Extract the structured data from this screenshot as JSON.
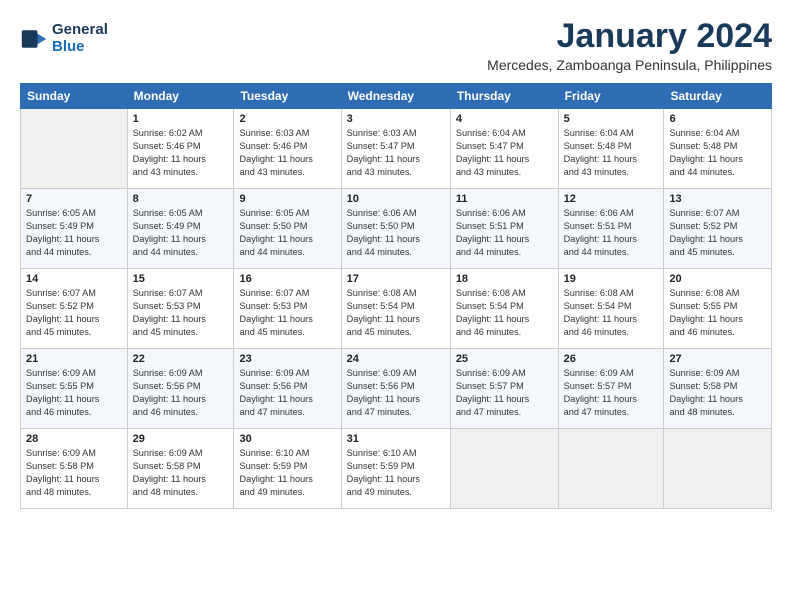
{
  "header": {
    "logo_line1": "General",
    "logo_line2": "Blue",
    "title": "January 2024",
    "location": "Mercedes, Zamboanga Peninsula, Philippines"
  },
  "weekdays": [
    "Sunday",
    "Monday",
    "Tuesday",
    "Wednesday",
    "Thursday",
    "Friday",
    "Saturday"
  ],
  "weeks": [
    [
      {
        "day": "",
        "sunrise": "",
        "sunset": "",
        "daylight": ""
      },
      {
        "day": "1",
        "sunrise": "6:02 AM",
        "sunset": "5:46 PM",
        "daylight": "11 hours and 43 minutes."
      },
      {
        "day": "2",
        "sunrise": "6:03 AM",
        "sunset": "5:46 PM",
        "daylight": "11 hours and 43 minutes."
      },
      {
        "day": "3",
        "sunrise": "6:03 AM",
        "sunset": "5:47 PM",
        "daylight": "11 hours and 43 minutes."
      },
      {
        "day": "4",
        "sunrise": "6:04 AM",
        "sunset": "5:47 PM",
        "daylight": "11 hours and 43 minutes."
      },
      {
        "day": "5",
        "sunrise": "6:04 AM",
        "sunset": "5:48 PM",
        "daylight": "11 hours and 43 minutes."
      },
      {
        "day": "6",
        "sunrise": "6:04 AM",
        "sunset": "5:48 PM",
        "daylight": "11 hours and 44 minutes."
      }
    ],
    [
      {
        "day": "7",
        "sunrise": "6:05 AM",
        "sunset": "5:49 PM",
        "daylight": "11 hours and 44 minutes."
      },
      {
        "day": "8",
        "sunrise": "6:05 AM",
        "sunset": "5:49 PM",
        "daylight": "11 hours and 44 minutes."
      },
      {
        "day": "9",
        "sunrise": "6:05 AM",
        "sunset": "5:50 PM",
        "daylight": "11 hours and 44 minutes."
      },
      {
        "day": "10",
        "sunrise": "6:06 AM",
        "sunset": "5:50 PM",
        "daylight": "11 hours and 44 minutes."
      },
      {
        "day": "11",
        "sunrise": "6:06 AM",
        "sunset": "5:51 PM",
        "daylight": "11 hours and 44 minutes."
      },
      {
        "day": "12",
        "sunrise": "6:06 AM",
        "sunset": "5:51 PM",
        "daylight": "11 hours and 44 minutes."
      },
      {
        "day": "13",
        "sunrise": "6:07 AM",
        "sunset": "5:52 PM",
        "daylight": "11 hours and 45 minutes."
      }
    ],
    [
      {
        "day": "14",
        "sunrise": "6:07 AM",
        "sunset": "5:52 PM",
        "daylight": "11 hours and 45 minutes."
      },
      {
        "day": "15",
        "sunrise": "6:07 AM",
        "sunset": "5:53 PM",
        "daylight": "11 hours and 45 minutes."
      },
      {
        "day": "16",
        "sunrise": "6:07 AM",
        "sunset": "5:53 PM",
        "daylight": "11 hours and 45 minutes."
      },
      {
        "day": "17",
        "sunrise": "6:08 AM",
        "sunset": "5:54 PM",
        "daylight": "11 hours and 45 minutes."
      },
      {
        "day": "18",
        "sunrise": "6:08 AM",
        "sunset": "5:54 PM",
        "daylight": "11 hours and 46 minutes."
      },
      {
        "day": "19",
        "sunrise": "6:08 AM",
        "sunset": "5:54 PM",
        "daylight": "11 hours and 46 minutes."
      },
      {
        "day": "20",
        "sunrise": "6:08 AM",
        "sunset": "5:55 PM",
        "daylight": "11 hours and 46 minutes."
      }
    ],
    [
      {
        "day": "21",
        "sunrise": "6:09 AM",
        "sunset": "5:55 PM",
        "daylight": "11 hours and 46 minutes."
      },
      {
        "day": "22",
        "sunrise": "6:09 AM",
        "sunset": "5:56 PM",
        "daylight": "11 hours and 46 minutes."
      },
      {
        "day": "23",
        "sunrise": "6:09 AM",
        "sunset": "5:56 PM",
        "daylight": "11 hours and 47 minutes."
      },
      {
        "day": "24",
        "sunrise": "6:09 AM",
        "sunset": "5:56 PM",
        "daylight": "11 hours and 47 minutes."
      },
      {
        "day": "25",
        "sunrise": "6:09 AM",
        "sunset": "5:57 PM",
        "daylight": "11 hours and 47 minutes."
      },
      {
        "day": "26",
        "sunrise": "6:09 AM",
        "sunset": "5:57 PM",
        "daylight": "11 hours and 47 minutes."
      },
      {
        "day": "27",
        "sunrise": "6:09 AM",
        "sunset": "5:58 PM",
        "daylight": "11 hours and 48 minutes."
      }
    ],
    [
      {
        "day": "28",
        "sunrise": "6:09 AM",
        "sunset": "5:58 PM",
        "daylight": "11 hours and 48 minutes."
      },
      {
        "day": "29",
        "sunrise": "6:09 AM",
        "sunset": "5:58 PM",
        "daylight": "11 hours and 48 minutes."
      },
      {
        "day": "30",
        "sunrise": "6:10 AM",
        "sunset": "5:59 PM",
        "daylight": "11 hours and 49 minutes."
      },
      {
        "day": "31",
        "sunrise": "6:10 AM",
        "sunset": "5:59 PM",
        "daylight": "11 hours and 49 minutes."
      },
      {
        "day": "",
        "sunrise": "",
        "sunset": "",
        "daylight": ""
      },
      {
        "day": "",
        "sunrise": "",
        "sunset": "",
        "daylight": ""
      },
      {
        "day": "",
        "sunrise": "",
        "sunset": "",
        "daylight": ""
      }
    ]
  ]
}
